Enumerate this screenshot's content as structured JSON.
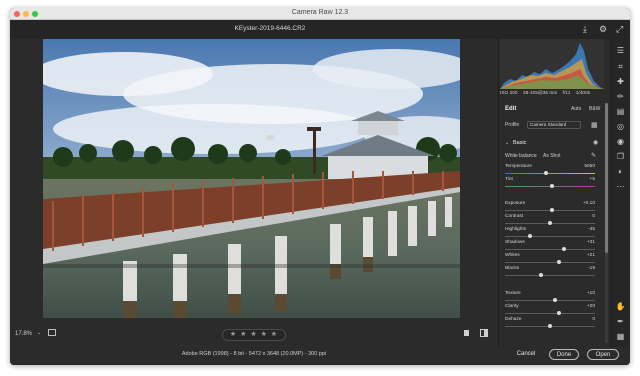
{
  "window": {
    "title": "Camera Raw 12.3"
  },
  "file": {
    "name": "KEyster-2019-6446.CR2",
    "info": "Adobe RGB (1998) - 8 bit - 5472 x 3648 (20.0MP) - 300 ppi"
  },
  "histogram": {
    "exif": [
      "ISO 200",
      "28-105@35 mm",
      "f/11",
      "1/400s"
    ]
  },
  "edit": {
    "title": "Edit",
    "auto_label": "Auto",
    "bw_label": "B&W",
    "profile_label": "Profile",
    "profile_value": "Camera Standard",
    "basic_label": "Basic",
    "wb_label": "White balance",
    "wb_value": "As Shot",
    "sliders": [
      {
        "label": "Temperature",
        "value": "5050",
        "pos": 0.45
      },
      {
        "label": "Tint",
        "value": "+5",
        "pos": 0.52
      },
      {
        "label": "Exposure",
        "value": "+0.10",
        "pos": 0.52
      },
      {
        "label": "Contrast",
        "value": "0",
        "pos": 0.5
      },
      {
        "label": "Highlights",
        "value": "-45",
        "pos": 0.28
      },
      {
        "label": "Shadows",
        "value": "+31",
        "pos": 0.65
      },
      {
        "label": "Whites",
        "value": "+21",
        "pos": 0.6
      },
      {
        "label": "Blacks",
        "value": "-19",
        "pos": 0.4
      },
      {
        "label": "Texture",
        "value": "+10",
        "pos": 0.55
      },
      {
        "label": "Clarity",
        "value": "+20",
        "pos": 0.6
      },
      {
        "label": "Dehaze",
        "value": "0",
        "pos": 0.5
      }
    ]
  },
  "bottom": {
    "zoom": "17.8%",
    "rating": "★ ★ ★ ★ ★"
  },
  "buttons": {
    "cancel": "Cancel",
    "done": "Done",
    "open": "Open"
  }
}
